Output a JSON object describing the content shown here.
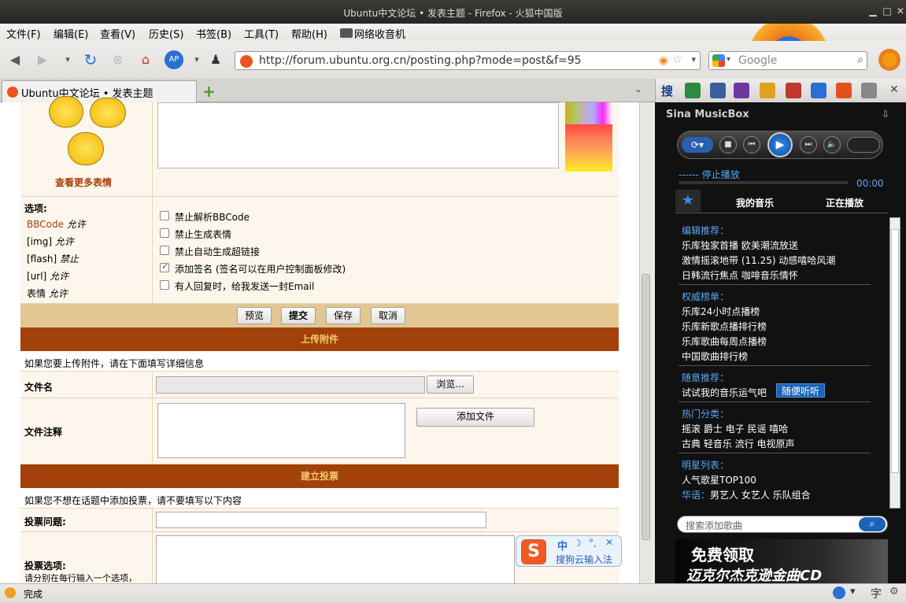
{
  "window": {
    "title": "Ubuntu中文论坛 • 发表主题 - Firefox - 火狐中国版"
  },
  "menu": [
    "文件(F)",
    "编辑(E)",
    "查看(V)",
    "历史(S)",
    "书签(B)",
    "工具(T)",
    "帮助(H)",
    "网络收音机"
  ],
  "nav": {
    "url": "http://forum.ubuntu.org.cn/posting.php?mode=post&f=95",
    "search_placeholder": "Google"
  },
  "tabs": [
    {
      "label": "Ubuntu中文论坛 • 发表主题"
    }
  ],
  "post": {
    "more_smilies": "查看更多表情",
    "options_label": "选项:",
    "perms": [
      {
        "name": "BBCode",
        "state": "允许"
      },
      {
        "name": "[img]",
        "state": "允许"
      },
      {
        "name": "[flash]",
        "state": "禁止"
      },
      {
        "name": "[url]",
        "state": "允许"
      },
      {
        "name": "表情",
        "state": "允许"
      }
    ],
    "checkboxes": [
      {
        "label": "禁止解析BBCode",
        "checked": false
      },
      {
        "label": "禁止生成表情",
        "checked": false
      },
      {
        "label": "禁止自动生成超链接",
        "checked": false
      },
      {
        "label": "添加签名 (签名可以在用户控制面板修改)",
        "checked": true
      },
      {
        "label": "有人回复时，给我发送一封Email",
        "checked": false
      }
    ],
    "buttons": {
      "preview": "预览",
      "submit": "提交",
      "save": "保存",
      "cancel": "取消"
    }
  },
  "upload": {
    "title": "上传附件",
    "hint": "如果您要上传附件，请在下面填写详细信息",
    "filename_label": "文件名",
    "browse": "浏览...",
    "comment_label": "文件注释",
    "add_file": "添加文件"
  },
  "poll": {
    "title": "建立投票",
    "hint": "如果您不想在话题中添加投票，请不要填写以下内容",
    "question_label": "投票问题:",
    "options_label": "投票选项:",
    "options_hint": "请分别在每行输入一个选项，"
  },
  "ime": {
    "mode": "中",
    "name": "搜狗云输入法"
  },
  "status": {
    "text": "完成"
  },
  "musicbox": {
    "title": "Sina MusicBox",
    "state": "停止播放",
    "time": "00:00",
    "tabs": [
      "我的音乐",
      "正在播放"
    ],
    "sections": [
      {
        "title": "编辑推荐：",
        "lines": [
          "乐库独家首播  欧美潮流放送",
          "激情摇滚地带 (11.25)  动感嘻哈风潮",
          "日韩流行焦点  咖啡音乐情怀"
        ]
      },
      {
        "title": "权威榜单：",
        "lines": [
          "乐库24小时点播榜",
          "乐库新歌点播排行榜",
          "乐库歌曲每周点播榜",
          "中国歌曲排行榜"
        ]
      },
      {
        "title": "随意推荐：",
        "lines": [
          "试试我的音乐运气吧"
        ]
      },
      {
        "title": "热门分类：",
        "lines": [
          "摇滚  爵士  电子  民谣  嘻哈",
          "古典  轻音乐  流行  电视原声"
        ]
      },
      {
        "title": "明星列表：",
        "lines": [
          "人气歌星TOP100"
        ]
      }
    ],
    "random_btn": "随便听听",
    "huayu": "华语：",
    "huayu_items": "男艺人  女艺人  乐队组合",
    "search_placeholder": "搜索添加歌曲",
    "ad_line1": "免费领取",
    "ad_line2": "迈克尔杰克逊金曲CD"
  }
}
